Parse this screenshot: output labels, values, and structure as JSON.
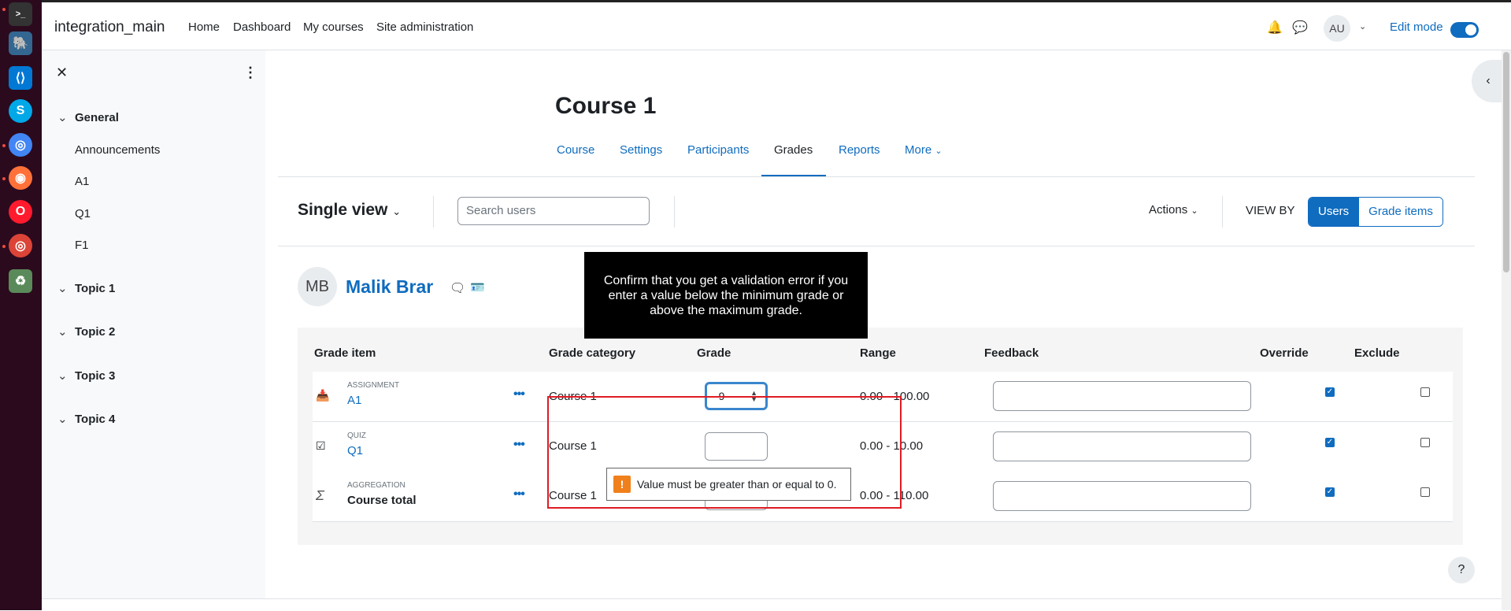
{
  "site": {
    "name": "integration_main"
  },
  "nav": {
    "home": "Home",
    "dashboard": "Dashboard",
    "my_courses": "My courses",
    "site_admin": "Site administration"
  },
  "user_menu": {
    "initials": "AU"
  },
  "edit_mode": {
    "label": "Edit mode",
    "on": true
  },
  "drawer": {
    "sections": [
      {
        "title": "General",
        "items": [
          "Announcements",
          "A1",
          "Q1",
          "F1"
        ]
      },
      {
        "title": "Topic 1"
      },
      {
        "title": "Topic 2"
      },
      {
        "title": "Topic 3"
      },
      {
        "title": "Topic 4"
      }
    ]
  },
  "course": {
    "title": "Course 1",
    "tabs": [
      "Course",
      "Settings",
      "Participants",
      "Grades",
      "Reports",
      "More"
    ],
    "active_tab": "Grades"
  },
  "grader": {
    "view_label": "Single view",
    "search_placeholder": "Search users",
    "actions_label": "Actions",
    "view_by_label": "VIEW BY",
    "view_by_options": [
      "Users",
      "Grade items"
    ],
    "view_by_selected": "Users"
  },
  "student": {
    "initials": "MB",
    "name": "Malik Brar"
  },
  "tooltip": {
    "text": "Confirm that you get a validation error if you enter a value below the minimum grade or above the maximum grade."
  },
  "table": {
    "headers": [
      "Grade item",
      "Grade category",
      "Grade",
      "Range",
      "Feedback",
      "Override",
      "Exclude"
    ],
    "rows": [
      {
        "type": "ASSIGNMENT",
        "name": "A1",
        "category": "Course 1",
        "grade": "-9",
        "range": "0.00 - 100.00",
        "override": true,
        "exclude": false
      },
      {
        "type": "QUIZ",
        "name": "Q1",
        "category": "Course 1",
        "grade": "",
        "range": "0.00 - 10.00",
        "override": true,
        "exclude": false
      },
      {
        "type": "AGGREGATION",
        "name": "Course total",
        "category": "Course 1",
        "grade": "",
        "range": "0.00 - 110.00",
        "override": true,
        "exclude": false
      }
    ]
  },
  "validation": {
    "message": "Value must be greater than or equal to 0."
  },
  "help": {
    "label": "?"
  },
  "icons": {
    "close": "close-icon",
    "kebab": "kebab-icon",
    "bell": "bell-icon",
    "chat": "chat-icon",
    "assign": "assignment-icon",
    "quiz": "quiz-icon",
    "sigma": "sigma-icon",
    "warning": "warning-icon"
  },
  "colors": {
    "brand": "#0f6cbf",
    "error_outline": "#e01b24",
    "warning": "#f0801b"
  }
}
